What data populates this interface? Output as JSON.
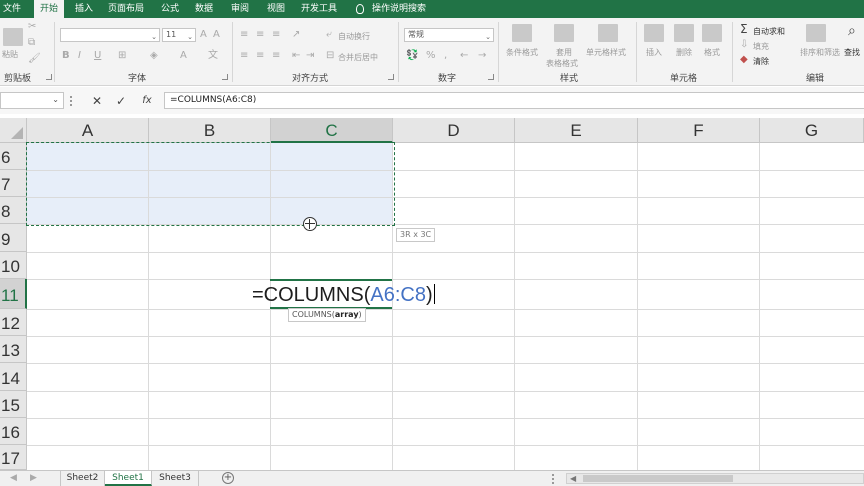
{
  "menu": {
    "tabs": [
      "文件",
      "开始",
      "插入",
      "页面布局",
      "公式",
      "数据",
      "审阅",
      "视图",
      "开发工具"
    ],
    "active_tab": "开始",
    "tell_me": "操作说明搜索"
  },
  "ribbon": {
    "clipboard": {
      "label": "剪贴板",
      "paste": "粘贴"
    },
    "font": {
      "label": "字体",
      "size": "11"
    },
    "alignment": {
      "label": "对齐方式",
      "wrap": "自动换行",
      "merge": "合并后居中"
    },
    "number": {
      "label": "数字",
      "format": "常规"
    },
    "styles": {
      "label": "样式",
      "conditional": "条件格式",
      "table_format_1": "套用",
      "table_format_2": "表格格式",
      "cell_styles": "单元格样式"
    },
    "cells": {
      "label": "单元格",
      "insert": "插入",
      "delete": "删除",
      "format": "格式"
    },
    "editing": {
      "label": "编辑",
      "autosum": "自动求和",
      "fill": "填充",
      "clear": "清除",
      "sort": "排序和筛选",
      "find": "查找"
    }
  },
  "formula_bar": {
    "name_box": "",
    "cancel": "✕",
    "enter": "✓",
    "fx": "fx",
    "formula": "=COLUMNS(A6:C8)"
  },
  "grid": {
    "columns": [
      "A",
      "B",
      "C",
      "D",
      "E",
      "F",
      "G"
    ],
    "rows": [
      "6",
      "7",
      "8",
      "9",
      "10",
      "11",
      "12",
      "13",
      "14",
      "15",
      "16",
      "17"
    ],
    "selected_column": "C",
    "selected_row": "11",
    "range_size_tip": "3R x 3C",
    "edit": {
      "prefix": "=COLUMNS(",
      "reference": "A6:C8",
      "suffix": ")"
    },
    "function_tip": {
      "name": "COLUMNS(",
      "arg": "array",
      "close": ")"
    }
  },
  "sheets": {
    "tabs": [
      "Sheet2",
      "Sheet1",
      "Sheet3"
    ],
    "active": "Sheet1",
    "add": "+"
  },
  "colors": {
    "accent": "#217346",
    "selection_fill": "#e7eef9",
    "reference": "#4472c4"
  }
}
